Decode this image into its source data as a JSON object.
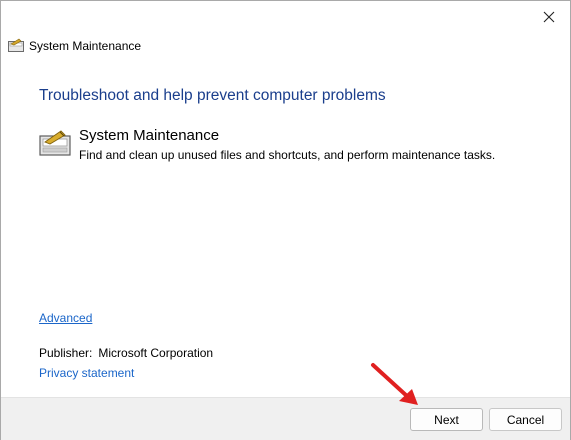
{
  "window": {
    "title": "System Maintenance",
    "title_icon": "system-maintenance-icon",
    "close_icon": "close-icon"
  },
  "main": {
    "heading": "Troubleshoot and help prevent computer problems",
    "task": {
      "icon": "system-maintenance-icon",
      "title": "System Maintenance",
      "description": "Find and clean up unused files and shortcuts, and perform maintenance tasks."
    },
    "advanced_link": "Advanced",
    "publisher_label": "Publisher:",
    "publisher_value": "Microsoft Corporation",
    "privacy_link": "Privacy statement"
  },
  "footer": {
    "next_label": "Next",
    "cancel_label": "Cancel"
  },
  "colors": {
    "heading": "#1a3e8c",
    "link": "#1b66c9",
    "footer_bg": "#f0f0f0",
    "annotation_arrow": "#e02020"
  }
}
